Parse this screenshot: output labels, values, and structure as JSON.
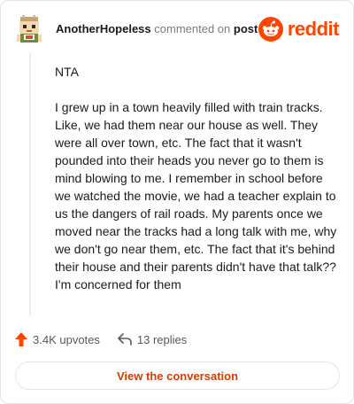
{
  "header": {
    "author": "AnotherHopeless",
    "action_text": "commented on",
    "post_link": "post",
    "brand": "reddit"
  },
  "comment": {
    "paragraphs": [
      "NTA",
      "I grew up in a town heavily filled with train tracks. Like, we had them near our house as well. They were all over town, etc. The fact that it wasn't pounded into their heads you never go to them is mind blowing to me. I remember in school before we watched the movie, we had a teacher explain to us the dangers of rail roads. My parents once we moved near the tracks had a long talk with me, why we don't go near them, etc. The fact that it's behind their house and their parents didn't have that talk?? I'm concerned for them"
    ]
  },
  "actions": {
    "upvotes": "3.4K upvotes",
    "replies": "13 replies"
  },
  "cta": {
    "label": "View the conversation"
  },
  "colors": {
    "accent": "#ff4500",
    "cta_text": "#d93a00",
    "border": "#e3e5e8"
  },
  "icons": [
    "avatar",
    "reddit-snoo-icon",
    "upvote-arrow-icon",
    "reply-arrow-icon"
  ]
}
